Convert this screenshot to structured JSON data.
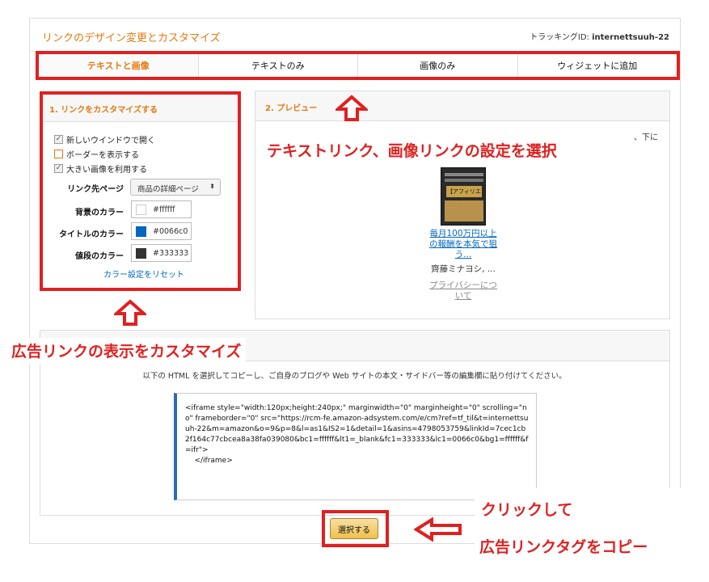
{
  "header": {
    "title": "リンクのデザイン変更とカスタマイズ",
    "tracking_label": "トラッキングID: ",
    "tracking_id": "internettsuuh-22"
  },
  "tabs": [
    {
      "label": "テキストと画像",
      "active": true
    },
    {
      "label": "テキストのみ",
      "active": false
    },
    {
      "label": "画像のみ",
      "active": false
    },
    {
      "label": "ウィジェットに追加",
      "active": false
    }
  ],
  "customize": {
    "title": "1. リンクをカスタマイズする",
    "checkboxes": [
      {
        "label": "新しいウインドウで開く",
        "checked": true
      },
      {
        "label": "ボーダーを表示する",
        "checked": false
      },
      {
        "label": "大きい画像を利用する",
        "checked": true
      }
    ],
    "link_dest_label": "リンク先ページ",
    "link_dest_value": "商品の詳細ページ",
    "bg_color_label": "背景のカラー",
    "bg_color_value": "#ffffff",
    "title_color_label": "タイトルのカラー",
    "title_color_value": "#0066c0",
    "price_color_label": "値段のカラー",
    "price_color_value": "#333333",
    "reset_label": "カラー設定をリセット"
  },
  "preview": {
    "title": "2. プレビュー",
    "partial_text": "、下に",
    "book_cover_text": "【アフィリエイト】上級バイブル",
    "ad_title": "毎月100万円以上の報酬を本気で狙う...",
    "ad_author": "齊藤ミナヨシ, ...",
    "privacy": "プライバシーについて"
  },
  "code": {
    "instruction": "以下の HTML を選択してコピーし、ご自身のブログや Web サイトの本文・サイドバー等の編集欄に貼り付けてください。",
    "snippet": "<iframe style=\"width:120px;height:240px;\" marginwidth=\"0\" marginheight=\"0\" scrolling=\"no\" frameborder=\"0\" src=\"https://rcm-fe.amazon-adsystem.com/e/cm?ref=tf_til&t=internettsuuh-22&m=amazon&o=9&p=8&l=as1&IS2=1&detail=1&asins=4798053759&linkId=7cec1cb2f164c77cbcea8a38fa039080&bc1=ffffff&lt1=_blank&fc1=333333&lc1=0066c0&bg1=ffffff&f=ifr\">\n    </iframe>",
    "select_button": "選択する"
  },
  "annotations": {
    "top": "テキストリンク、画像リンクの設定を選択",
    "left": "広告リンクの表示をカスタマイズ",
    "click_line1": "クリックして",
    "click_line2": "広告リンクタグをコピー"
  },
  "colors": {
    "accent_orange": "#e47911",
    "link_blue": "#0066c0",
    "annotation_red": "#e02020",
    "swatch_bg": "#ffffff",
    "swatch_title": "#0066c0",
    "swatch_price": "#333333"
  }
}
